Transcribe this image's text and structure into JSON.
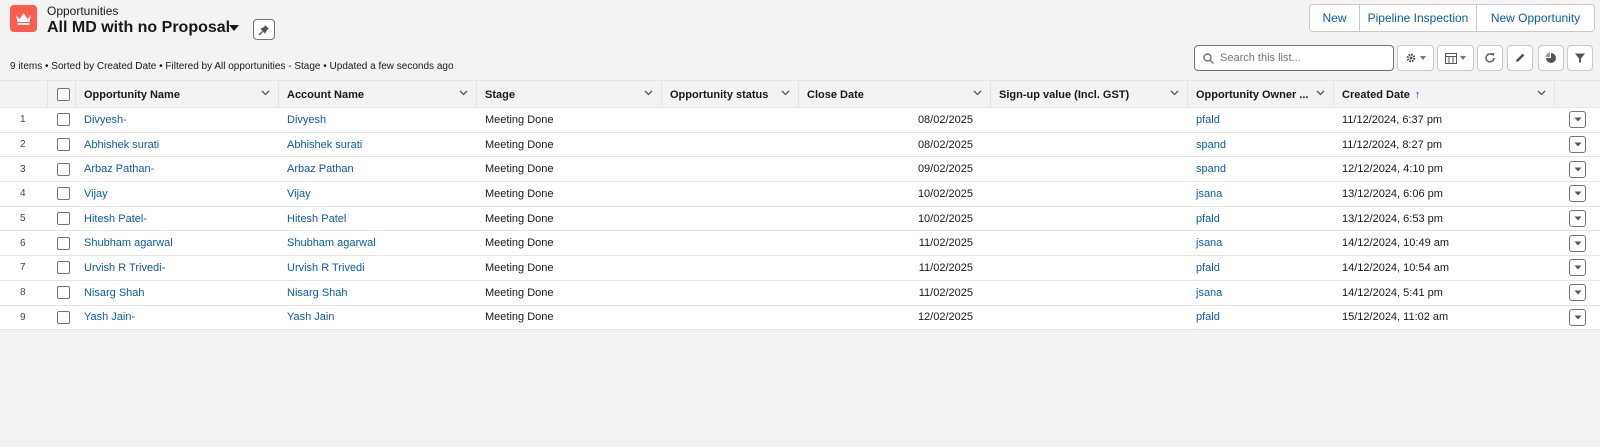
{
  "header": {
    "object_label": "Opportunities",
    "view_title": "All MD with no Proposal",
    "icons": {
      "app": "crown-icon",
      "pin": "pin-icon"
    }
  },
  "actions": {
    "new": "New",
    "pipeline": "Pipeline Inspection",
    "new_opportunity": "New Opportunity"
  },
  "meta_text": "9 items • Sorted by Created Date • Filtered by All opportunities - Stage • Updated a few seconds ago",
  "search": {
    "placeholder": "Search this list..."
  },
  "toolbar_icons": [
    "gear-icon",
    "table-icon",
    "refresh-icon",
    "pencil-icon",
    "chart-icon",
    "filter-icon"
  ],
  "columns": [
    "Opportunity Name",
    "Account Name",
    "Stage",
    "Opportunity status",
    "Close Date",
    "Sign-up value (Incl. GST)",
    "Opportunity Owner ...",
    "Created Date"
  ],
  "sort_indicator": "↑",
  "rows": [
    {
      "n": "1",
      "opp": "Divyesh-",
      "acct": "Divyesh",
      "stage": "Meeting Done",
      "status": "",
      "close": "08/02/2025",
      "value": "",
      "owner": "pfald",
      "created": "11/12/2024, 6:37 pm"
    },
    {
      "n": "2",
      "opp": "Abhishek surati",
      "acct": "Abhishek surati",
      "stage": "Meeting Done",
      "status": "",
      "close": "08/02/2025",
      "value": "",
      "owner": "spand",
      "created": "11/12/2024, 8:27 pm"
    },
    {
      "n": "3",
      "opp": "Arbaz Pathan-",
      "acct": "Arbaz Pathan",
      "stage": "Meeting Done",
      "status": "",
      "close": "09/02/2025",
      "value": "",
      "owner": "spand",
      "created": "12/12/2024, 4:10 pm"
    },
    {
      "n": "4",
      "opp": "Vijay",
      "acct": "Vijay",
      "stage": "Meeting Done",
      "status": "",
      "close": "10/02/2025",
      "value": "",
      "owner": "jsana",
      "created": "13/12/2024, 6:06 pm"
    },
    {
      "n": "5",
      "opp": "Hitesh Patel-",
      "acct": "Hitesh Patel",
      "stage": "Meeting Done",
      "status": "",
      "close": "10/02/2025",
      "value": "",
      "owner": "pfald",
      "created": "13/12/2024, 6:53 pm"
    },
    {
      "n": "6",
      "opp": "Shubham agarwal",
      "acct": "Shubham agarwal",
      "stage": "Meeting Done",
      "status": "",
      "close": "11/02/2025",
      "value": "",
      "owner": "jsana",
      "created": "14/12/2024, 10:49 am"
    },
    {
      "n": "7",
      "opp": "Urvish R Trivedi-",
      "acct": "Urvish R Trivedi",
      "stage": "Meeting Done",
      "status": "",
      "close": "11/02/2025",
      "value": "",
      "owner": "pfald",
      "created": "14/12/2024, 10:54 am"
    },
    {
      "n": "8",
      "opp": "Nisarg Shah",
      "acct": "Nisarg Shah",
      "stage": "Meeting Done",
      "status": "",
      "close": "11/02/2025",
      "value": "",
      "owner": "jsana",
      "created": "14/12/2024, 5:41 pm"
    },
    {
      "n": "9",
      "opp": "Yash Jain-",
      "acct": "Yash Jain",
      "stage": "Meeting Done",
      "status": "",
      "close": "12/02/2025",
      "value": "",
      "owner": "pfald",
      "created": "15/12/2024, 11:02 am"
    }
  ],
  "colors": {
    "brand": "#fe5c4c",
    "link": "#0b5cab",
    "background": "#f3f3f3"
  }
}
